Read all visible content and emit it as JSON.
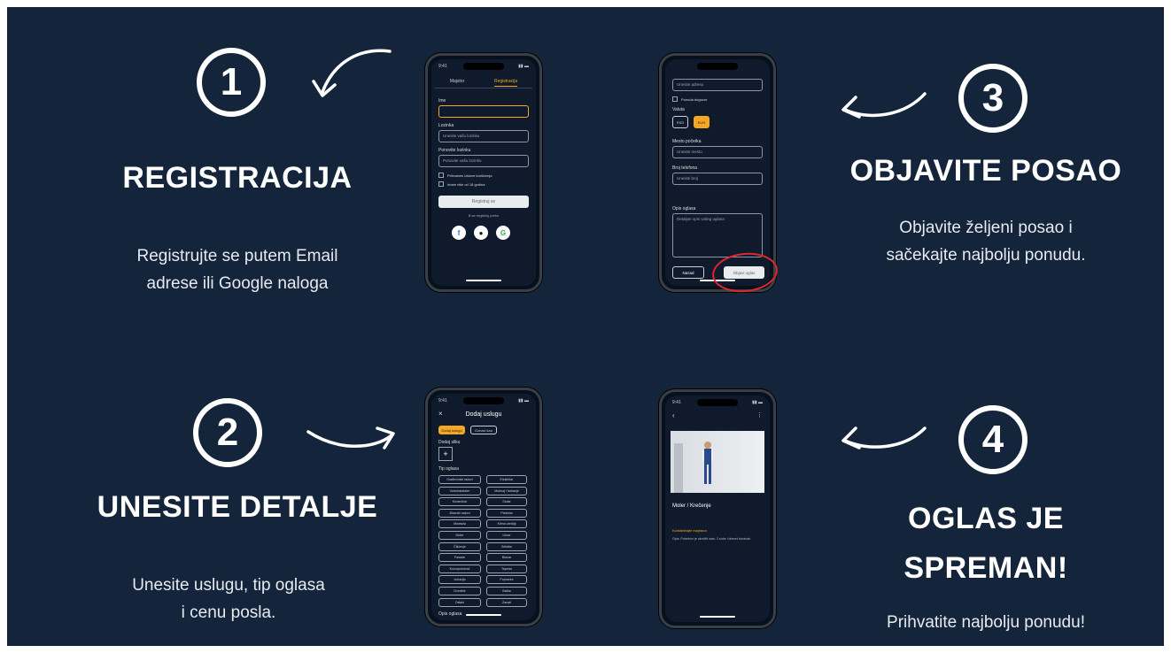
{
  "steps": [
    {
      "number": "1",
      "title": "REGISTRACIJA",
      "desc_line1": "Registrujte se putem Email",
      "desc_line2": "adrese ili Google naloga"
    },
    {
      "number": "2",
      "title": "UNESITE DETALJE",
      "desc_line1": "Unesite uslugu, tip oglasa",
      "desc_line2": "i cenu posla."
    },
    {
      "number": "3",
      "title": "OBJAVITE POSAO",
      "desc_line1": "Objavite željeni posao i",
      "desc_line2": "sačekajte najbolju ponudu."
    },
    {
      "number": "4",
      "title_line1": "OGLAS JE",
      "title_line2": "SPREMAN!",
      "desc_line1": "Prihvatite najbolju ponudu!"
    }
  ],
  "phone1": {
    "time": "9:41",
    "tab_login": "Majstor",
    "tab_register": "Registracija",
    "label_name": "Ime",
    "label_email": "Lozinka",
    "email_placeholder": "Unesite vašu lozinku",
    "label_password": "Ponovite lozinku",
    "password_placeholder": "Ponovite vašu lozinku",
    "check1": "Prihvatam Uslove korišćenja",
    "check2": "Imam više od 18 godina",
    "register_button": "Registruj se",
    "or_text": "ili se registruj preko"
  },
  "phone2": {
    "time": "9:41",
    "title": "Dodaj uslugu",
    "toggle_a": "Dodaj uslugu",
    "toggle_b": "Oznaci kao",
    "label_photo": "Dodaj sliku",
    "label_type": "Tip oglasa",
    "chips": [
      "Građevinski radovi",
      "Električar",
      "Vodoinstalater",
      "Moleraj i farbanje",
      "Keramičar",
      "Stolar",
      "Zidarski radovi",
      "Parketar",
      "Montaža",
      "Klima uređaji",
      "Moler",
      "Limar",
      "Čišćenje",
      "Selidbe",
      "Fasade",
      "Bravar",
      "Krovopokrivač",
      "Tapetar",
      "Izolacija",
      "Popravke",
      "Dvorište",
      "Bašta",
      "Ostalo",
      "Zanati"
    ],
    "bottom_label": "Opis oglasa"
  },
  "phone3": {
    "field1": "Unesite adresu",
    "check": "Ponuda dogovor",
    "label_currency": "Valuta",
    "currency_a": "RSD",
    "currency_b": "EUR",
    "label_budget": "Mesto početka",
    "budget_placeholder": "Unesite mesto",
    "label_address": "Broj telefona",
    "address_placeholder": "Unesite broj",
    "label_desc": "Opis oglasa",
    "desc_placeholder": "Detaljan opis vašeg oglasa",
    "back_button": "Nazad",
    "publish_button": "Objavi oglas"
  },
  "phone4": {
    "time": "9:41",
    "job_title": "Moler / Krečenje",
    "job_sub": "Kontaktirajte majstora",
    "job_desc": "Opis: Potrebno je okrečiti stan, 2 sobe i dnevni boravak."
  },
  "colors": {
    "background": "#14243a",
    "accent": "#f5a623",
    "highlight": "#e0262d"
  }
}
